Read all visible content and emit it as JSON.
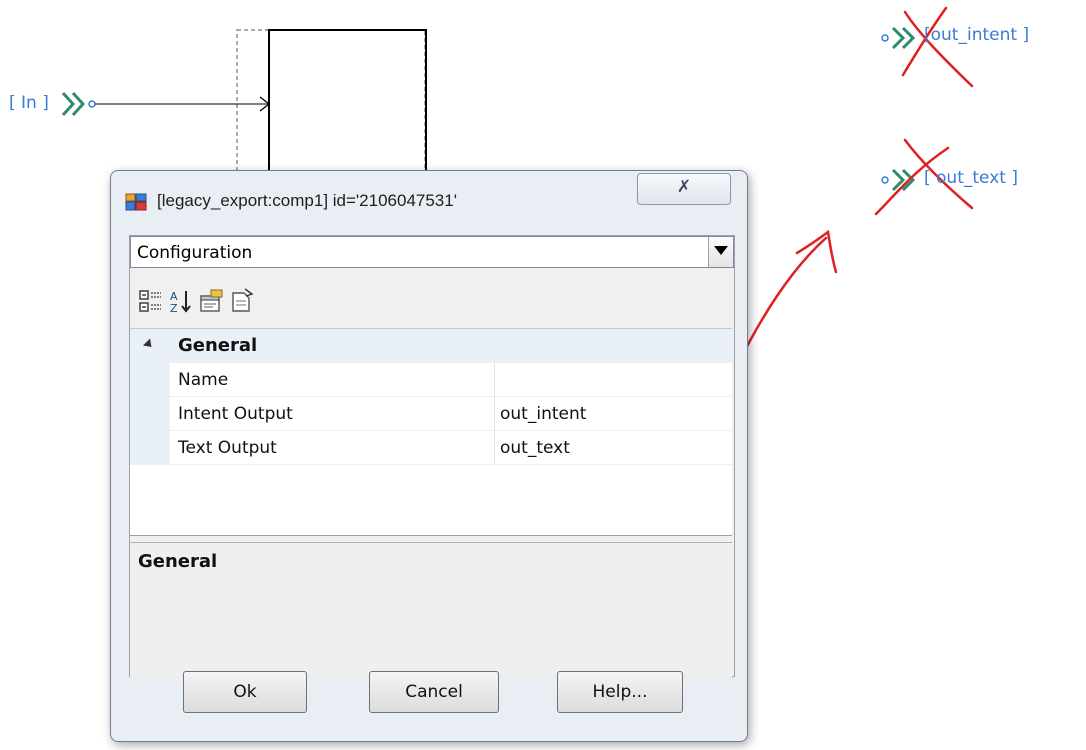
{
  "canvas": {
    "in_port_label": "[ In ]",
    "out_intent_label": "[out_intent ]",
    "out_text_label": "[ out_text ]"
  },
  "dialog": {
    "title": "[legacy_export:comp1] id='2106047531'",
    "close_glyph": "✗",
    "category_dropdown": "Configuration",
    "toolbar": {
      "icons": [
        "categorized-icon",
        "alphabetical-sort-icon",
        "property-pages-icon",
        "events-icon"
      ]
    },
    "grid": {
      "category": "General",
      "properties": [
        {
          "name": "Name",
          "value": ""
        },
        {
          "name": "Intent Output",
          "value": "out_intent"
        },
        {
          "name": "Text Output",
          "value": "out_text"
        }
      ]
    },
    "description_title": "General",
    "buttons": {
      "ok": "Ok",
      "cancel": "Cancel",
      "help": "Help..."
    }
  },
  "colors": {
    "port_label": "#3a7bd5",
    "port_arrow": "#2e8b6e",
    "annotation": "#e02020"
  }
}
